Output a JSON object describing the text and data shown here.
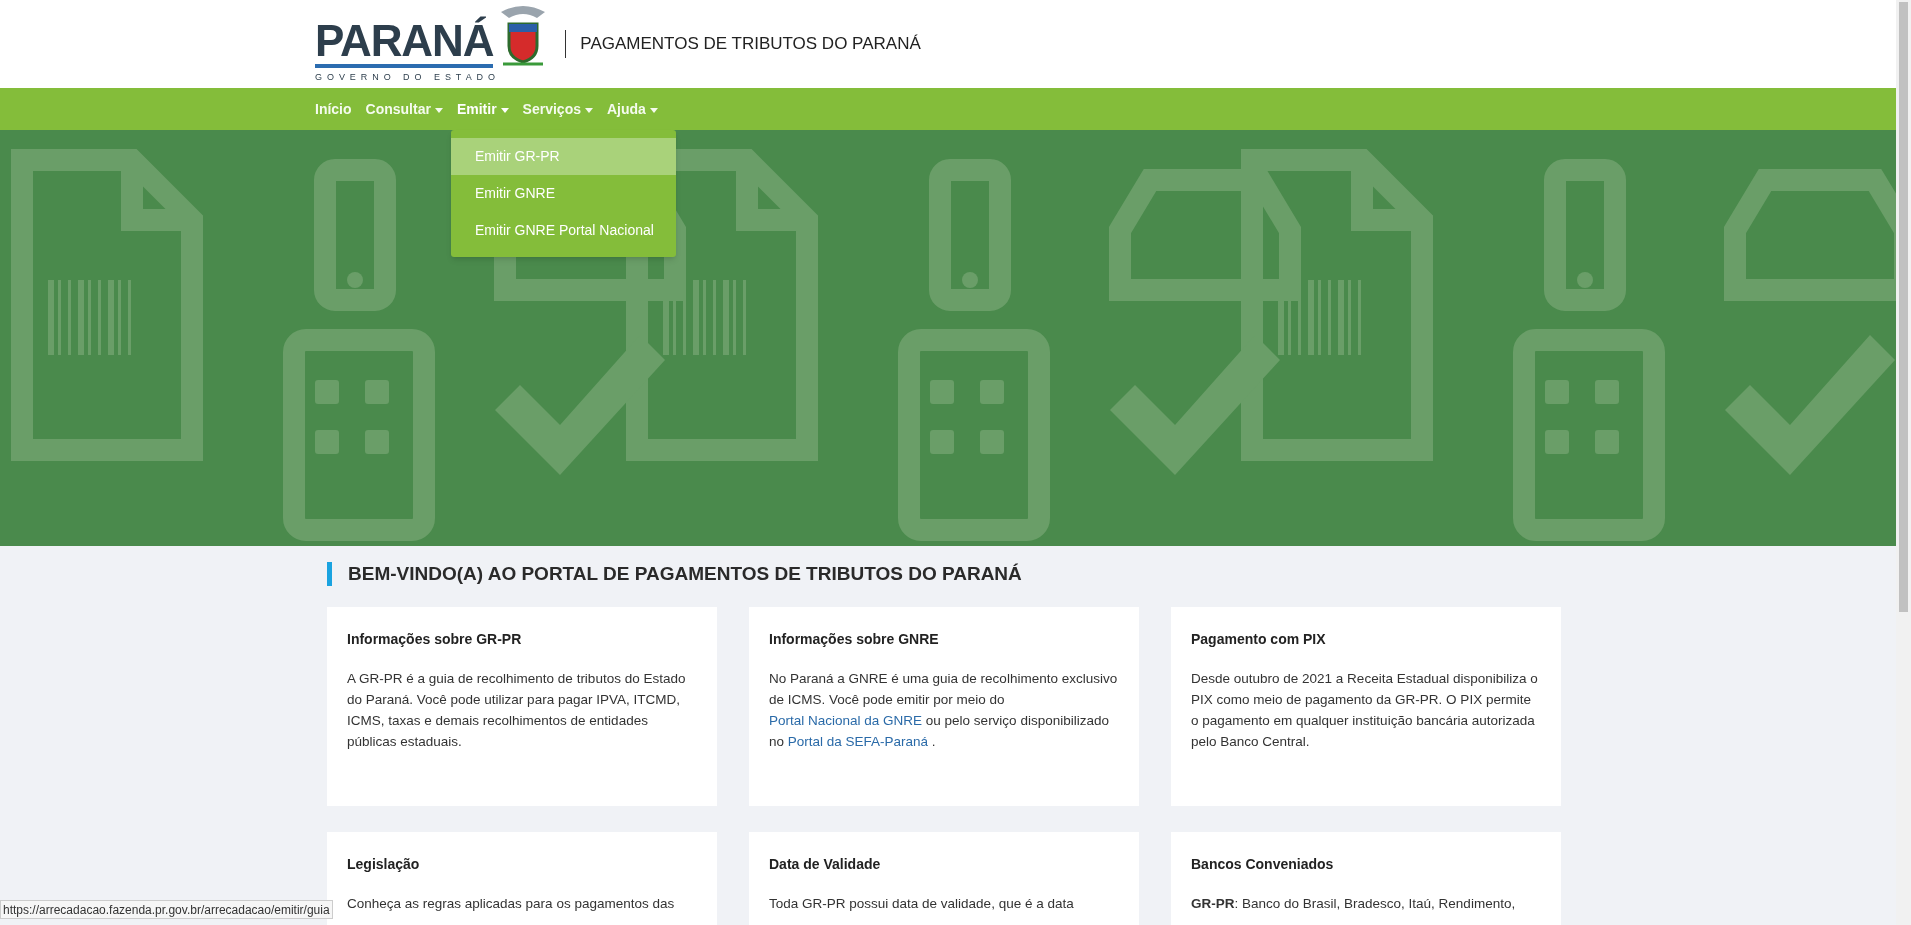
{
  "header": {
    "logo_text": "PARANÁ",
    "logo_subtitle": "GOVERNO DO ESTADO",
    "site_title": "PAGAMENTOS DE TRIBUTOS DO PARANÁ"
  },
  "nav": [
    {
      "label": "Início",
      "dropdown": false,
      "expanded": false
    },
    {
      "label": "Consultar",
      "dropdown": true,
      "expanded": false
    },
    {
      "label": "Emitir",
      "dropdown": true,
      "expanded": true,
      "items": [
        {
          "label": "Emitir GR-PR",
          "selected": true
        },
        {
          "label": "Emitir GNRE",
          "selected": false
        },
        {
          "label": "Emitir GNRE Portal Nacional",
          "selected": false
        }
      ]
    },
    {
      "label": "Serviços",
      "dropdown": true,
      "expanded": false
    },
    {
      "label": "Ajuda",
      "dropdown": true,
      "expanded": false
    }
  ],
  "welcome_title": "BEM-VINDO(A) AO PORTAL DE PAGAMENTOS DE TRIBUTOS DO PARANÁ",
  "cards": [
    {
      "title": "Informações sobre GR-PR",
      "body": [
        {
          "kind": "text",
          "text": "A GR-PR é a guia de recolhimento de tributos do Estado do Paraná. Você pode utilizar para pagar IPVA, ITCMD, ICMS, taxas e demais recolhimentos de entidades públicas estaduais."
        }
      ]
    },
    {
      "title": "Informações sobre GNRE",
      "body": [
        {
          "kind": "text",
          "text": "No Paraná a GNRE é uma guia de recolhimento exclusivo de ICMS. Você pode emitir por meio do "
        },
        {
          "kind": "link",
          "text": "Portal Nacional da GNRE"
        },
        {
          "kind": "text",
          "text": " ou pelo serviço disponibilizado no "
        },
        {
          "kind": "link",
          "text": "Portal da SEFA-Paraná"
        },
        {
          "kind": "text",
          "text": " ."
        }
      ]
    },
    {
      "title": "Pagamento com PIX",
      "body": [
        {
          "kind": "text",
          "text": "Desde outubro de 2021 a Receita Estadual disponibiliza o PIX como meio de pagamento da GR-PR. O PIX permite o pagamento em qualquer instituição bancária autorizada pelo Banco Central."
        }
      ]
    },
    {
      "title": "Legislação",
      "body": [
        {
          "kind": "text",
          "text": "Conheça as regras aplicadas para os pagamentos das"
        }
      ]
    },
    {
      "title": "Data de Validade",
      "body": [
        {
          "kind": "text",
          "text": "Toda GR-PR possui data de validade, que é a data"
        }
      ]
    },
    {
      "title": "Bancos Conveniados",
      "body": [
        {
          "kind": "text",
          "text": "**GR-PR**: Banco do Brasil, Bradesco, Itaú, Rendimento,"
        }
      ]
    }
  ],
  "status_url": "https://arrecadacao.fazenda.pr.gov.br/arrecadacao/emitir/guia"
}
